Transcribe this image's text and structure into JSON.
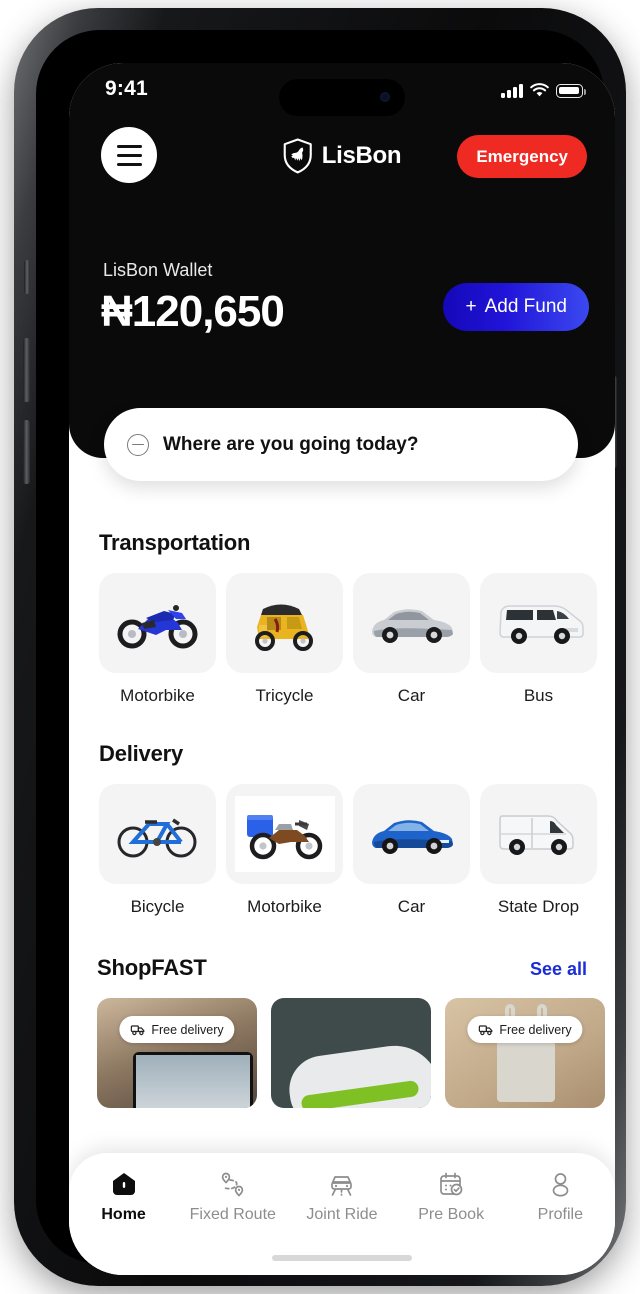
{
  "status_bar": {
    "time": "9:41",
    "signal_icon": "signal-bars-icon",
    "wifi_icon": "wifi-icon",
    "battery_icon": "battery-full-icon"
  },
  "header": {
    "menu_icon": "hamburger-menu-icon",
    "logo_icon": "shield-horse-logo-icon",
    "brand": "LisBon",
    "emergency_label": "Emergency"
  },
  "wallet": {
    "label": "LisBon Wallet",
    "amount": "₦120,650",
    "add_fund_label": "Add Fund",
    "add_fund_plus": "+",
    "gradient_start": "#1508b8",
    "gradient_end": "#3b49f0"
  },
  "search": {
    "icon": "destination-circle-icon",
    "placeholder": "Where are you going today?"
  },
  "transportation": {
    "title": "Transportation",
    "items": [
      {
        "label": "Motorbike",
        "icon": "sport-motorbike-icon"
      },
      {
        "label": "Tricycle",
        "icon": "keke-tricycle-icon"
      },
      {
        "label": "Car",
        "icon": "silver-sedan-icon"
      },
      {
        "label": "Bus",
        "icon": "white-minibus-icon"
      }
    ]
  },
  "delivery": {
    "title": "Delivery",
    "items": [
      {
        "label": "Bicycle",
        "icon": "bicycle-icon"
      },
      {
        "label": "Motorbike",
        "icon": "delivery-motorbike-icon"
      },
      {
        "label": "Car",
        "icon": "blue-sedan-icon"
      },
      {
        "label": "State Drop",
        "icon": "cargo-van-icon"
      }
    ]
  },
  "shopfast": {
    "title": "ShopFAST",
    "see_all": "See all",
    "badge_label": "Free delivery",
    "badge_icon": "delivery-truck-icon",
    "cards": [
      {
        "name": "laptop-on-couch",
        "badge": true,
        "bg": "#8a7260"
      },
      {
        "name": "green-sneaker",
        "badge": false,
        "bg": "#3e4b4a"
      },
      {
        "name": "tote-bag",
        "badge": true,
        "bg": "#c9b193"
      },
      {
        "name": "gray-product",
        "badge": false,
        "bg": "#b8bbbd"
      }
    ]
  },
  "bottom_nav": {
    "items": [
      {
        "label": "Home",
        "icon": "home-filled-icon",
        "active": true
      },
      {
        "label": "Fixed Route",
        "icon": "route-pins-icon",
        "active": false
      },
      {
        "label": "Joint Ride",
        "icon": "car-front-icon",
        "active": false
      },
      {
        "label": "Pre Book",
        "icon": "calendar-check-icon",
        "active": false
      },
      {
        "label": "Profile",
        "icon": "person-icon",
        "active": false
      }
    ]
  }
}
